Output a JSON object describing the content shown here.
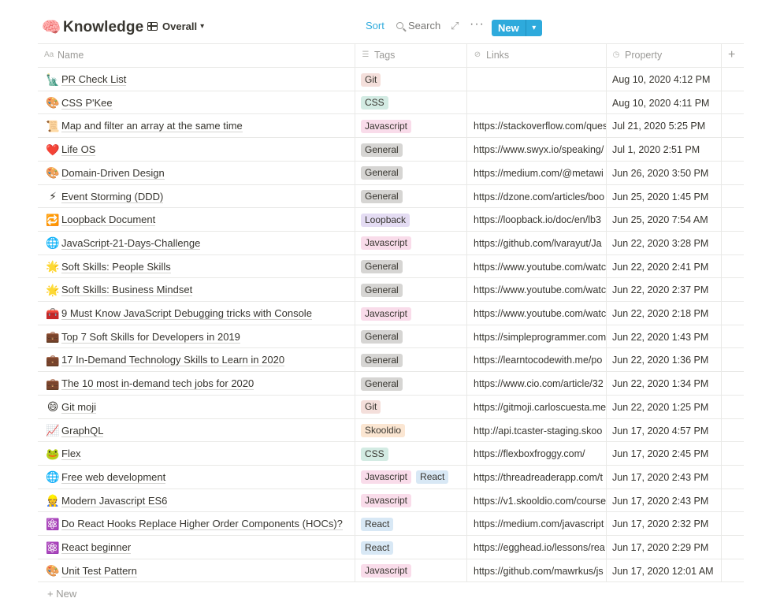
{
  "header": {
    "emoji": "🧠",
    "title": "Knowledge",
    "view_label": "Overall",
    "sort_label": "Sort",
    "search_label": "Search",
    "new_label": "New"
  },
  "columns": [
    {
      "label": "Name",
      "icon": "text-property-icon"
    },
    {
      "label": "Tags",
      "icon": "multi-select-icon"
    },
    {
      "label": "Links",
      "icon": "url-property-icon"
    },
    {
      "label": "Property",
      "icon": "created-time-icon"
    }
  ],
  "tag_colors": {
    "Git": {
      "bg": "#f4dfdb",
      "fg": "#37352f"
    },
    "CSS": {
      "bg": "#d3ebe3",
      "fg": "#37352f"
    },
    "Javascript": {
      "bg": "#f9dcea",
      "fg": "#37352f"
    },
    "General": {
      "bg": "#d6d5d3",
      "fg": "#37352f"
    },
    "Loopback": {
      "bg": "#e4dcf3",
      "fg": "#37352f"
    },
    "Skooldio": {
      "bg": "#fbe6d2",
      "fg": "#37352f"
    },
    "React": {
      "bg": "#d8e8f5",
      "fg": "#37352f"
    }
  },
  "rows": [
    {
      "emoji": "🗽",
      "name": "PR Check List",
      "tags": [
        "Git"
      ],
      "link": "",
      "date": "Aug 10, 2020 4:12 PM"
    },
    {
      "emoji": "🎨",
      "name": "CSS P'Kee",
      "tags": [
        "CSS"
      ],
      "link": "",
      "date": "Aug 10, 2020 4:11 PM"
    },
    {
      "emoji": "📜",
      "name": "Map and filter an array at the same time",
      "tags": [
        "Javascript"
      ],
      "link": "https://stackoverflow.com/questions",
      "date": "Jul 21, 2020 5:25 PM"
    },
    {
      "emoji": "❤️",
      "name": "Life OS",
      "tags": [
        "General"
      ],
      "link": "https://www.swyx.io/speaking/",
      "date": "Jul 1, 2020 2:51 PM"
    },
    {
      "emoji": "🎨",
      "name": "Domain-Driven Design",
      "tags": [
        "General"
      ],
      "link": "https://medium.com/@metawi",
      "date": "Jun 26, 2020 3:50 PM"
    },
    {
      "emoji": "⚡",
      "name": "Event Storming (DDD)",
      "tags": [
        "General"
      ],
      "link": "https://dzone.com/articles/boo",
      "date": "Jun 25, 2020 1:45 PM"
    },
    {
      "emoji": "🔁",
      "name": "Loopback Document",
      "tags": [
        "Loopback"
      ],
      "link": "https://loopback.io/doc/en/lb3",
      "date": "Jun 25, 2020 7:54 AM"
    },
    {
      "emoji": "🌐",
      "name": "JavaScript-21-Days-Challenge",
      "tags": [
        "Javascript"
      ],
      "link": "https://github.com/lvarayut/Ja",
      "date": "Jun 22, 2020 3:28 PM"
    },
    {
      "emoji": "🌟",
      "name": "Soft Skills: People Skills",
      "tags": [
        "General"
      ],
      "link": "https://www.youtube.com/watch",
      "date": "Jun 22, 2020 2:41 PM"
    },
    {
      "emoji": "🌟",
      "name": "Soft Skills: Business Mindset",
      "tags": [
        "General"
      ],
      "link": "https://www.youtube.com/watch",
      "date": "Jun 22, 2020 2:37 PM"
    },
    {
      "emoji": "🧰",
      "name": "9 Must Know JavaScript Debugging tricks with Console",
      "tags": [
        "Javascript"
      ],
      "link": "https://www.youtube.com/watch",
      "date": "Jun 22, 2020 2:18 PM"
    },
    {
      "emoji": "💼",
      "name": "Top 7 Soft Skills for Developers in 2019",
      "tags": [
        "General"
      ],
      "link": "https://simpleprogrammer.com",
      "date": "Jun 22, 2020 1:43 PM"
    },
    {
      "emoji": "💼",
      "name": "17 In-Demand Technology Skills to Learn in 2020",
      "tags": [
        "General"
      ],
      "link": "https://learntocodewith.me/po",
      "date": "Jun 22, 2020 1:36 PM"
    },
    {
      "emoji": "💼",
      "name": "The 10 most in-demand tech jobs for 2020",
      "tags": [
        "General"
      ],
      "link": "https://www.cio.com/article/32",
      "date": "Jun 22, 2020 1:34 PM"
    },
    {
      "emoji": "😄",
      "name": "Git moji",
      "tags": [
        "Git"
      ],
      "link": "https://gitmoji.carloscuesta.me",
      "date": "Jun 22, 2020 1:25 PM"
    },
    {
      "emoji": "📈",
      "name": "GraphQL",
      "tags": [
        "Skooldio"
      ],
      "link": "http://api.tcaster-staging.skoo",
      "date": "Jun 17, 2020 4:57 PM"
    },
    {
      "emoji": "🐸",
      "name": "Flex",
      "tags": [
        "CSS"
      ],
      "link": "https://flexboxfroggy.com/",
      "date": "Jun 17, 2020 2:45 PM"
    },
    {
      "emoji": "🌐",
      "name": "Free web development",
      "tags": [
        "Javascript",
        "React"
      ],
      "link": "https://threadreaderapp.com/t",
      "date": "Jun 17, 2020 2:43 PM"
    },
    {
      "emoji": "👷",
      "name": "Modern Javascript ES6",
      "tags": [
        "Javascript"
      ],
      "link": "https://v1.skooldio.com/course",
      "date": "Jun 17, 2020 2:43 PM"
    },
    {
      "emoji": "⚛️",
      "name": "Do React Hooks Replace Higher Order Components (HOCs)?",
      "tags": [
        "React"
      ],
      "link": "https://medium.com/javascript",
      "date": "Jun 17, 2020 2:32 PM"
    },
    {
      "emoji": "⚛️",
      "name": "React beginner",
      "tags": [
        "React"
      ],
      "link": "https://egghead.io/lessons/rea",
      "date": "Jun 17, 2020 2:29 PM"
    },
    {
      "emoji": "🎨",
      "name": "Unit Test Pattern",
      "tags": [
        "Javascript"
      ],
      "link": "https://github.com/mawrkus/js",
      "date": "Jun 17, 2020 12:01 AM"
    }
  ],
  "footer": {
    "new_label": "+ New"
  }
}
